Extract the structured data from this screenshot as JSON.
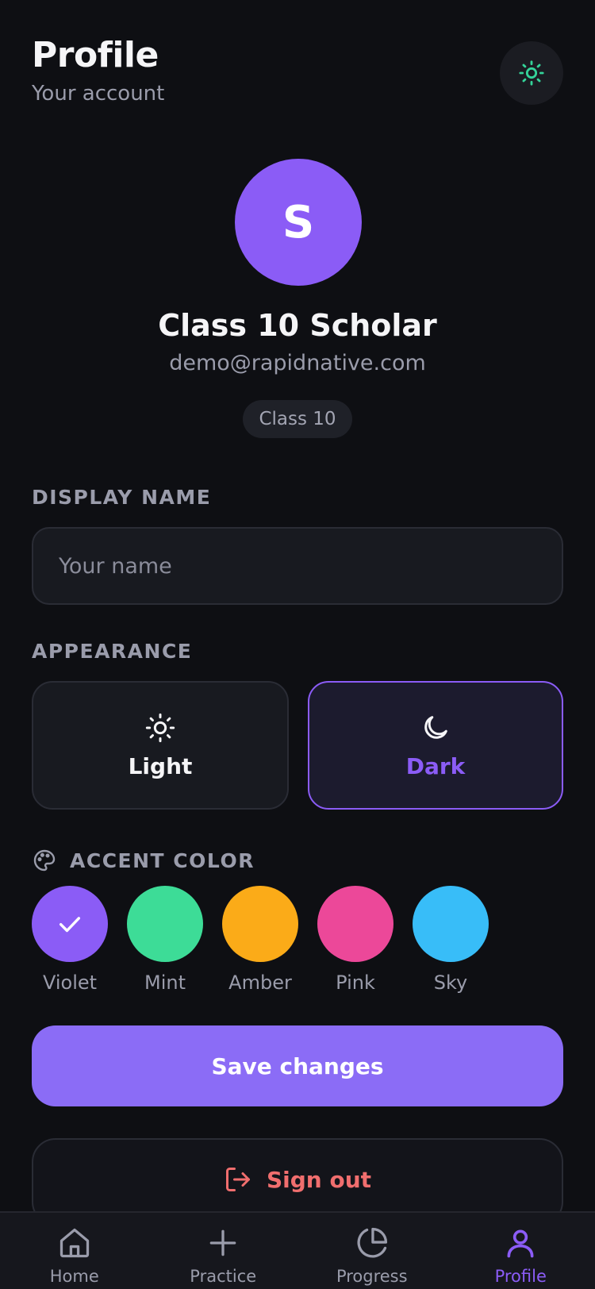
{
  "header": {
    "title": "Profile",
    "subtitle": "Your account"
  },
  "theme_toggle": {
    "icon": "sun-icon",
    "color": "#34d399"
  },
  "profile": {
    "initial": "S",
    "name": "Class 10 Scholar",
    "email": "demo@rapidnative.com",
    "badge": "Class 10",
    "avatar_color": "#8b5cf6"
  },
  "display_name": {
    "label": "DISPLAY NAME",
    "placeholder": "Your name",
    "value": ""
  },
  "appearance": {
    "label": "APPEARANCE",
    "options": [
      {
        "label": "Light",
        "icon": "sun-icon",
        "selected": false
      },
      {
        "label": "Dark",
        "icon": "moon-icon",
        "selected": true
      }
    ]
  },
  "accent": {
    "label": "ACCENT COLOR",
    "icon": "palette-icon",
    "colors": [
      {
        "label": "Violet",
        "color": "#8b5cf6",
        "selected": true
      },
      {
        "label": "Mint",
        "color": "#3ddc97",
        "selected": false
      },
      {
        "label": "Amber",
        "color": "#fbab18",
        "selected": false
      },
      {
        "label": "Pink",
        "color": "#ec4899",
        "selected": false
      },
      {
        "label": "Sky",
        "color": "#38bdf8",
        "selected": false
      }
    ]
  },
  "actions": {
    "save_label": "Save changes",
    "signout_label": "Sign out",
    "signout_color": "#f06e6e"
  },
  "tabs": [
    {
      "label": "Home",
      "icon": "home-icon",
      "active": false
    },
    {
      "label": "Practice",
      "icon": "plus-icon",
      "active": false
    },
    {
      "label": "Progress",
      "icon": "pie-chart-icon",
      "active": false
    },
    {
      "label": "Profile",
      "icon": "user-icon",
      "active": true
    }
  ]
}
